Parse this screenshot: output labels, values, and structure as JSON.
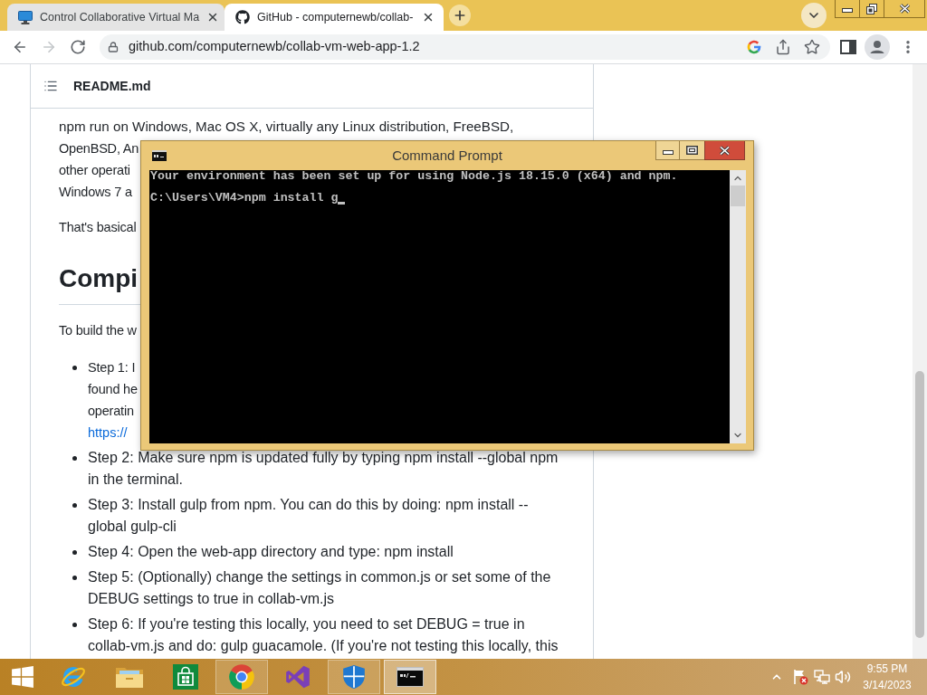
{
  "browser": {
    "tabs": [
      {
        "kind": "vm",
        "title": "Control Collaborative Virtual Ma",
        "selected": false
      },
      {
        "kind": "repo",
        "title": "GitHub - computernewb/collab-",
        "selected": true
      }
    ],
    "address": "github.com/computernewb/collab-vm-web-app-1.2"
  },
  "readme": {
    "header": "README.md",
    "intro_lines": [
      "npm run on Windows, Mac OS X, virtually any Linux distribution, FreeBSD,",
      "OpenBSD, An",
      "other operati",
      "Windows 7 a"
    ],
    "note": "That's basical",
    "heading": "Compi",
    "build_intro": "To build the w",
    "steps": [
      {
        "lines": [
          "Step 1: I",
          "found he",
          "operatin"
        ],
        "link": "https://"
      },
      {
        "lines": [
          "Step 2: Make sure npm is updated fully by typing npm install --global npm",
          "in the terminal."
        ]
      },
      {
        "lines": [
          "Step 3: Install gulp from npm. You can do this by doing: npm install --",
          "global gulp-cli"
        ]
      },
      {
        "lines": [
          "Step 4: Open the web-app directory and type: npm install"
        ]
      },
      {
        "lines": [
          "Step 5: (Optionally) change the settings in common.js or set some of the",
          "DEBUG settings to true in collab-vm.js"
        ]
      },
      {
        "lines": [
          "Step 6: If you're testing this locally, you need to set DEBUG = true in",
          "collab-vm.js and do: gulp guacamole. (If you're not testing this locally, this"
        ]
      }
    ]
  },
  "command_prompt": {
    "title": "Command Prompt",
    "output": "Your environment has been set up for using Node.js 18.15.0 (x64) and npm.",
    "command_line": "C:\\Users\\VM4>npm install g",
    "cursor": true
  },
  "taskbar": {
    "apps": [
      {
        "kind": "ie",
        "running": false,
        "selected": false
      },
      {
        "kind": "explorer",
        "running": false,
        "selected": false
      },
      {
        "kind": "store",
        "running": false,
        "selected": false
      },
      {
        "kind": "chrome",
        "running": true,
        "selected": false
      },
      {
        "kind": "vs",
        "running": false,
        "selected": false
      },
      {
        "kind": "defender",
        "running": true,
        "selected": false
      },
      {
        "kind": "cmd",
        "running": true,
        "selected": true
      }
    ],
    "clock": {
      "time": "9:55 PM",
      "date": "3/14/2023"
    }
  }
}
